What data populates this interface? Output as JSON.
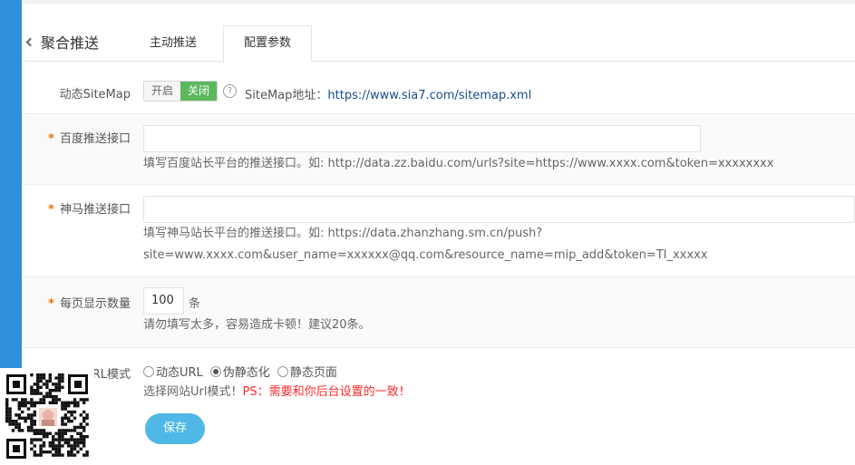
{
  "header": {
    "back_title": "聚合推送",
    "tabs": [
      {
        "label": "主动推送"
      },
      {
        "label": "配置参数"
      }
    ]
  },
  "sitemap": {
    "label": "动态SiteMap",
    "switch_on": "开启",
    "switch_off": "关闭",
    "help": "?",
    "address_label": "SiteMap地址：",
    "address_url": "https://www.sia7.com/sitemap.xml"
  },
  "baidu": {
    "required": "*",
    "label": "百度推送接口",
    "value": "",
    "hint": "填写百度站长平台的推送接口。如: http://data.zz.baidu.com/urls?site=https://www.xxxx.com&token=xxxxxxxx"
  },
  "shenma": {
    "required": "*",
    "label": "神马推送接口",
    "value": "",
    "hint_line1": "填写神马站长平台的推送接口。如: https://data.zhanzhang.sm.cn/push?",
    "hint_line2": "site=www.xxxx.com&user_name=xxxxxx@qq.com&resource_name=mip_add&token=TI_xxxxx"
  },
  "per_page": {
    "required": "*",
    "label": "每页显示数量",
    "value": "100",
    "unit": "条",
    "hint": "请勿填写太多，容易造成卡顿！建议20条。"
  },
  "url_mode": {
    "required": "*",
    "label": "URL模式",
    "options": [
      {
        "label": "动态URL",
        "checked": false
      },
      {
        "label": "伪静态化",
        "checked": true
      },
      {
        "label": "静态页面",
        "checked": false
      }
    ],
    "hint_normal": "选择网站Url模式！",
    "hint_warning": "PS：需要和你后台设置的一致！"
  },
  "actions": {
    "save_label": "保存"
  },
  "colors": {
    "accent_blue": "#4fb8e6",
    "switch_green": "#5cb85c",
    "required_orange": "#ff6a00",
    "warning_red": "#ff2a2a",
    "link_blue": "#1a4d8f",
    "sidebar_blue": "#2f8fdc"
  }
}
